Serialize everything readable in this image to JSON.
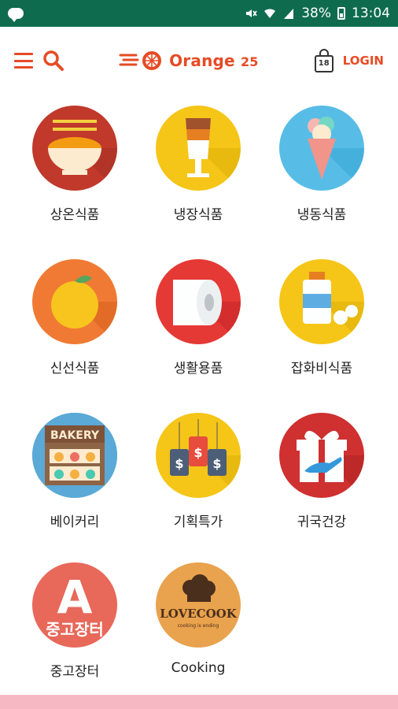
{
  "status": {
    "battery": "38%",
    "time": "13:04"
  },
  "header": {
    "logo_text": "Orange",
    "logo_number": "25",
    "cart_count": "18",
    "login": "LOGIN"
  },
  "categories": [
    {
      "label": "상온식품",
      "color": "#c0392b"
    },
    {
      "label": "냉장식품",
      "color": "#f5c518"
    },
    {
      "label": "냉동식품",
      "color": "#58bde6"
    },
    {
      "label": "신선식품",
      "color": "#f07a34"
    },
    {
      "label": "생활용품",
      "color": "#e53935"
    },
    {
      "label": "잡화비식품",
      "color": "#f5c518"
    },
    {
      "label": "베이커리",
      "color": "#5aa9d6"
    },
    {
      "label": "기획특가",
      "color": "#f5c518"
    },
    {
      "label": "귀국건강",
      "color": "#cf3030"
    },
    {
      "label": "중고장터",
      "color": "#e8685a"
    },
    {
      "label": "Cooking",
      "color": "#e9a24d"
    }
  ],
  "icons": {
    "bakery_sign": "BAKERY",
    "market_letter": "A",
    "market_text": "중고장터",
    "cook_text": "LOVECOOK",
    "cook_sub": "cooking is ending"
  }
}
